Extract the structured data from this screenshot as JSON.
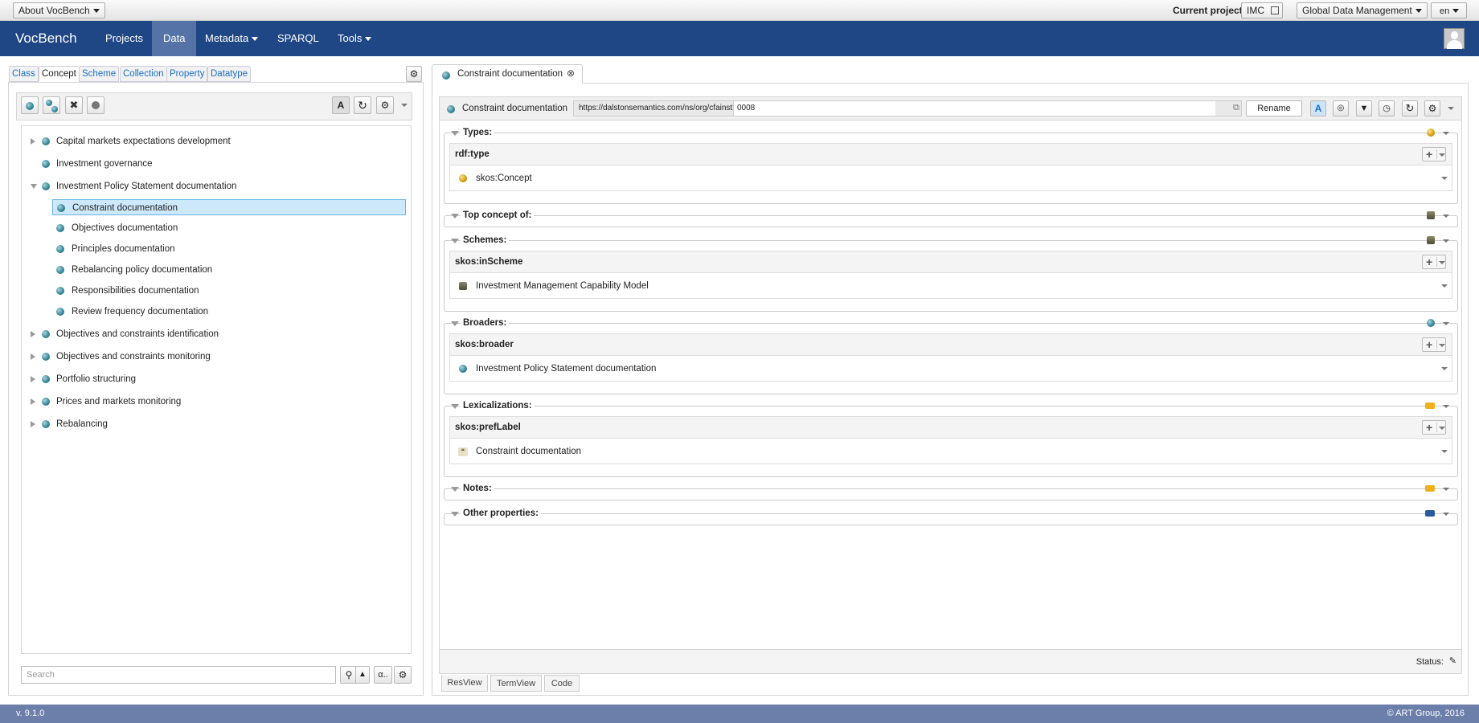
{
  "topbar": {
    "about_label": "About VocBench",
    "current_project_label": "Current project:",
    "project_name": "IMC",
    "workspace_label": "Global Data Management",
    "lang": "en"
  },
  "navbar": {
    "brand": "VocBench",
    "items": [
      "Projects",
      "Data",
      "Metadata",
      "SPARQL",
      "Tools"
    ]
  },
  "left_tabs": [
    "Class",
    "Concept",
    "Scheme",
    "Collection",
    "Property",
    "Datatype"
  ],
  "tree": [
    {
      "label": "Capital markets expectations development"
    },
    {
      "label": "Investment governance"
    },
    {
      "label": "Investment Policy Statement documentation"
    },
    {
      "label": "Constraint documentation"
    },
    {
      "label": "Objectives documentation"
    },
    {
      "label": "Principles documentation"
    },
    {
      "label": "Rebalancing policy documentation"
    },
    {
      "label": "Responsibilities documentation"
    },
    {
      "label": "Review frequency documentation"
    },
    {
      "label": "Objectives and constraints identification"
    },
    {
      "label": "Objectives and constraints monitoring"
    },
    {
      "label": "Portfolio structuring"
    },
    {
      "label": "Prices and markets monitoring"
    },
    {
      "label": "Rebalancing"
    }
  ],
  "search": {
    "placeholder": "Search",
    "alpha_label": "α.."
  },
  "resource_tab": {
    "label": "Constraint documentation"
  },
  "resource_header": {
    "label": "Constraint documentation",
    "namespace": "https://dalstonsemantics.com/ns/org/cfainstitute/imc/",
    "local_name": "0008",
    "rename_label": "Rename"
  },
  "sections": {
    "types": {
      "title": "Types:",
      "property": "rdf:type",
      "value": "skos:Concept"
    },
    "top_concept": {
      "title": "Top concept of:"
    },
    "schemes": {
      "title": "Schemes:",
      "property": "skos:inScheme",
      "value": "Investment Management Capability Model"
    },
    "broaders": {
      "title": "Broaders:",
      "property": "skos:broader",
      "value": "Investment Policy Statement documentation"
    },
    "lexicalizations": {
      "title": "Lexicalizations:",
      "property": "skos:prefLabel",
      "value": "Constraint documentation"
    },
    "notes": {
      "title": "Notes:"
    },
    "other": {
      "title": "Other properties:"
    }
  },
  "status_label": "Status:",
  "bottom_tabs": [
    "ResView",
    "TermView",
    "Code"
  ],
  "footer": {
    "version": "v. 9.1.0",
    "copyright": "© ART Group, 2016"
  }
}
